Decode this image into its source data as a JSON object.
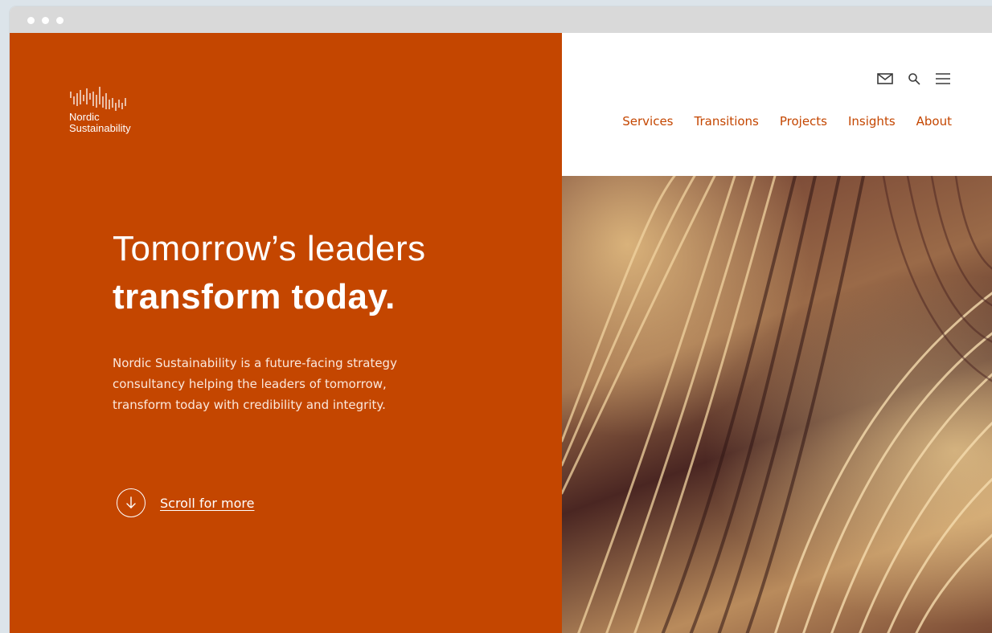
{
  "brand": {
    "name_line1": "Nordic",
    "name_line2": "Sustainability"
  },
  "colors": {
    "accent": "#c44600",
    "chrome": "#d9d9d9",
    "background": "#dce4ea"
  },
  "header": {
    "icons": [
      "mail-icon",
      "search-icon",
      "menu-icon"
    ],
    "nav": [
      {
        "label": "Services"
      },
      {
        "label": "Transitions"
      },
      {
        "label": "Projects"
      },
      {
        "label": "Insights"
      },
      {
        "label": "About"
      }
    ]
  },
  "hero": {
    "headline_light": "Tomorrow’s leaders",
    "headline_bold": "transform today.",
    "intro_line1": "Nordic Sustainability is a future-facing strategy",
    "intro_line2": "consultancy helping the leaders of tomorrow,",
    "intro_line3": "transform today with credibility and integrity.",
    "scroll_label": "Scroll for more"
  }
}
